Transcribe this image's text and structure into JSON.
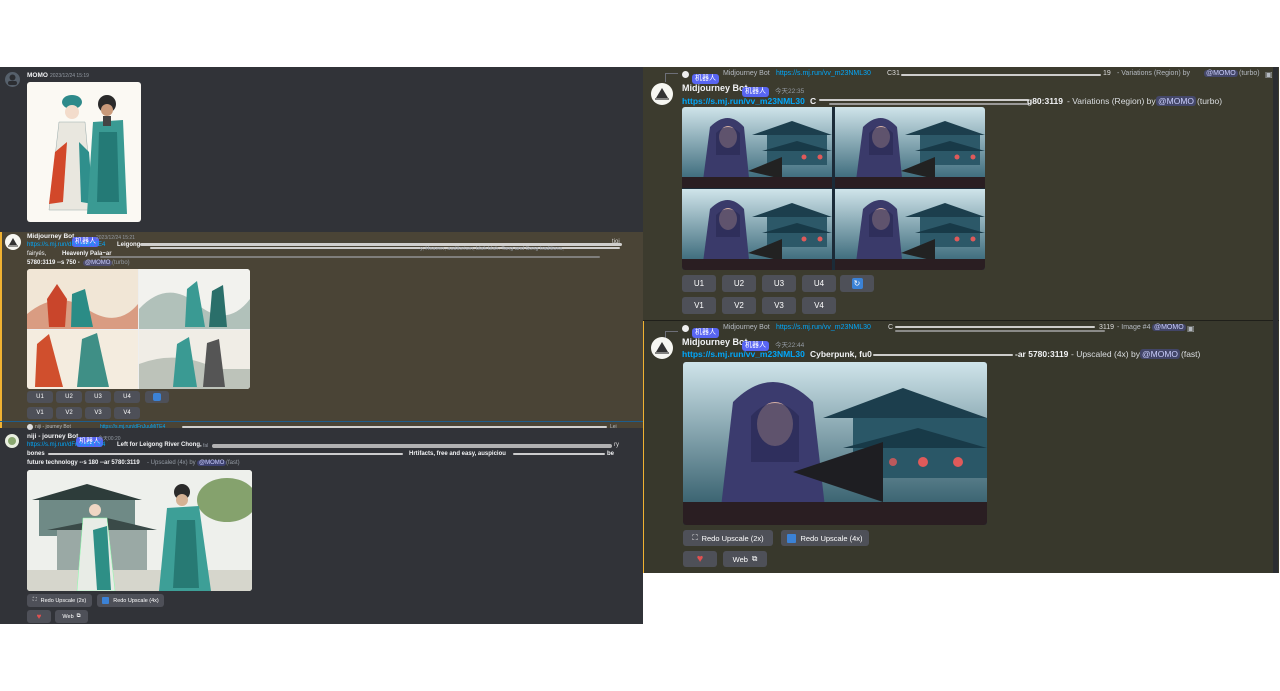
{
  "left": {
    "msg1": {
      "user": "MOMO",
      "time": "2023/12/24 15:19"
    },
    "msg2": {
      "user": "Midjourney Bot",
      "bot_tag": "机器人",
      "time": "2023/12/24 15:21",
      "link": "https://s.mj.run/dFnJuuMiTE4",
      "text_start": "Leigong",
      "trail1": "tioi",
      "trail2": "y, Heaven, auditorium, blah blah. Tang and Song traditions,",
      "line2_a": "fairyés,",
      "line2_b": "Heavenly Pala~ar",
      "line3": "5780:3119 --s 750 -",
      "mention": "@MOMO",
      "suffix": "(turbo)",
      "buttons_row1": [
        "U1",
        "U2",
        "U3",
        "U4"
      ],
      "buttons_row2": [
        "V1",
        "V2",
        "V3",
        "V4"
      ]
    },
    "msg3": {
      "reply_user": "niji - journey Bot",
      "reply_link": "https://s.mj.run/dFnJuuMiTE4",
      "reply_tail": "Lei",
      "user": "niji - journey Bot",
      "bot_tag": "机器人",
      "time": "今天00:20",
      "link": "https://s.mj.run/dFnJuuMiTE4",
      "text": "Left for Leigong River Chong,",
      "text_b": "fal",
      "tail1": "ry",
      "line2_a": "bones",
      "line2_b": "Hrtifacts, free and easy, auspiciou",
      "line2_c": "be",
      "line3": "future technology --s 180 --ar 5780:3119",
      "line3_b": "- Upscaled (4x) by",
      "mention": "@MOMO",
      "suffix": "(fast)",
      "redo2": "Redo Upscale (2x)",
      "redo4": "Redo Upscale (4x)",
      "web": "Web"
    }
  },
  "right": {
    "msg1": {
      "reply_tag": "机器人",
      "reply_user": "Midjourney Bot",
      "reply_link": "https://s.mj.run/vv_m23NML30",
      "reply_tail_a": "C31",
      "reply_tail_b": "19",
      "reply_suffix": "- Variations (Region) by",
      "reply_mention": "@MOMO",
      "reply_speed": "(turbo)",
      "user": "Midjourney Bot",
      "bot_tag": "机器人",
      "time": "今天22:35",
      "link": "https://s.mj.run/vv_m23NML30",
      "text_a": "C",
      "text_b": "g80:3119",
      "suffix": "- Variations (Region) by",
      "mention": "@MOMO",
      "speed": "(turbo)",
      "buttons_row1": [
        "U1",
        "U2",
        "U3",
        "U4"
      ],
      "buttons_row2": [
        "V1",
        "V2",
        "V3",
        "V4"
      ]
    },
    "msg2": {
      "reply_tag": "机器人",
      "reply_user": "Midjourney Bot",
      "reply_link": "https://s.mj.run/vv_m23NML30",
      "reply_tail_a": "C",
      "reply_tail_b": "3119",
      "reply_suffix": "- Image #4",
      "reply_mention": "@MOMO",
      "user": "Midjourney Bot",
      "bot_tag": "机器人",
      "time": "今天22:44",
      "link": "https://s.mj.run/vv_m23NML30",
      "text": "Cyberpunk, fu0",
      "text_b": "-ar 5780:3119",
      "suffix": "- Upscaled (4x) by",
      "mention": "@MOMO",
      "speed": "(fast)",
      "redo2": "Redo Upscale (2x)",
      "redo4": "Redo Upscale (4x)",
      "web": "Web"
    }
  }
}
